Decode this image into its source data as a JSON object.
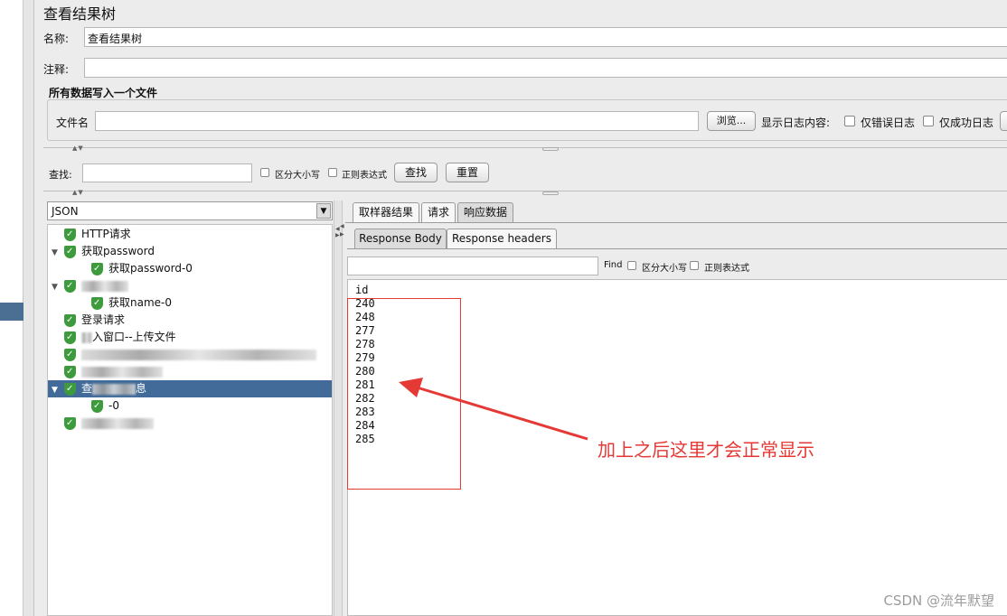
{
  "panel": {
    "title": "查看结果树",
    "name_label": "名称:",
    "name_value": "查看结果树",
    "comment_label": "注释:",
    "comment_value": "",
    "file_section_title": "所有数据写入一个文件",
    "filename_label": "文件名",
    "filename_value": "",
    "browse_button": "浏览...",
    "log_content_label": "显示日志内容:",
    "errors_only_label": "仅错误日志",
    "success_only_label": "仅成功日志"
  },
  "search": {
    "label": "查找:",
    "value": "",
    "case_label": "区分大小写",
    "regex_label": "正则表达式",
    "find_button": "查找",
    "reset_button": "重置"
  },
  "renderer": {
    "selected": "JSON"
  },
  "tree": {
    "items": [
      {
        "label": "HTTP请求",
        "indent": 0,
        "expand": ""
      },
      {
        "label": "获取password",
        "indent": 0,
        "expand": "▼"
      },
      {
        "label": "获取password-0",
        "indent": 1,
        "expand": ""
      },
      {
        "label": "",
        "indent": 0,
        "expand": "▼"
      },
      {
        "label": "获取name-0",
        "indent": 1,
        "expand": ""
      },
      {
        "label": "登录请求",
        "indent": 0,
        "expand": ""
      },
      {
        "label": "入窗口--上传文件",
        "indent": 0,
        "expand": ""
      },
      {
        "label": "",
        "indent": 0,
        "expand": ""
      },
      {
        "label": "",
        "indent": 0,
        "expand": ""
      },
      {
        "label": "查",
        "suffix": "息",
        "indent": 0,
        "expand": "▼",
        "selected": true
      },
      {
        "label": "-0",
        "indent": 1,
        "expand": ""
      },
      {
        "label": "",
        "indent": 0,
        "expand": ""
      }
    ]
  },
  "tabs": {
    "top": [
      "取样器结果",
      "请求",
      "响应数据"
    ],
    "sub": [
      "Response Body",
      "Response headers"
    ]
  },
  "response_find": {
    "find_label": "Find",
    "case_label": "区分大小写",
    "regex_label": "正则表达式",
    "value": ""
  },
  "response": {
    "lines": [
      "id",
      "240",
      "248",
      "277",
      "278",
      "279",
      "280",
      "281",
      "282",
      "283",
      "284",
      "285"
    ]
  },
  "annotation": {
    "text": "加上之后这里才会正常显示",
    "color": "#e53935"
  },
  "watermark": "CSDN @流年默望"
}
